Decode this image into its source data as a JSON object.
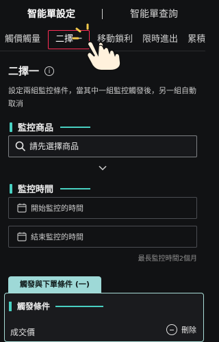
{
  "header": {
    "tabs": [
      {
        "label": "智能單設定"
      },
      {
        "label": "智能單查詢"
      }
    ]
  },
  "subtabs": [
    {
      "label": "觸價觸量"
    },
    {
      "label": "二擇一"
    },
    {
      "label": "移動鎖利"
    },
    {
      "label": "限時進出"
    },
    {
      "label": "累積"
    }
  ],
  "page": {
    "title": "二擇一",
    "description": "設定兩組監控條件，當其中一組監控觸發後，另一組自動取消"
  },
  "monitor_product": {
    "section_title": "監控商品",
    "placeholder": "請先選擇商品"
  },
  "monitor_time": {
    "section_title": "監控時間",
    "start_placeholder": "開始監控的時間",
    "end_placeholder": "結束監控的時間",
    "note": "最長監控時間2個月"
  },
  "condition": {
    "tab_label": "觸發與下單條件 (一)",
    "trigger_title": "觸發條件",
    "trade_label": "成交價",
    "delete_label": "刪除"
  },
  "colors": {
    "accent": "#49d1c2",
    "highlight": "#ff2d55",
    "background": "#111214"
  }
}
